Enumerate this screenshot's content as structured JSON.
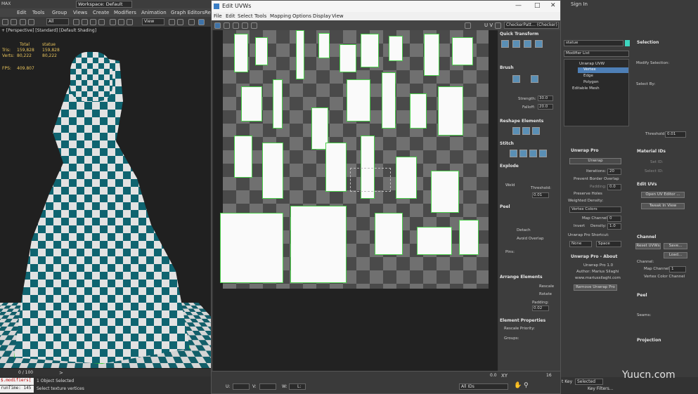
{
  "app": {
    "logo": "MAX",
    "workspace": "Workspace: Default",
    "menus": [
      "Edit",
      "Tools",
      "Group",
      "Views",
      "Create",
      "Modifiers",
      "Animation",
      "Graph Editors",
      "Re"
    ],
    "sign_in": "Sign In",
    "toolbar_filter": "All",
    "toolbar_view": "View"
  },
  "viewport": {
    "label": "+ [Perspective] [Standard] [Default Shading]",
    "stats_header_total": "Total",
    "stats_header_obj": "statue",
    "tris_label": "Tris:",
    "tris_total": "159,828",
    "tris_obj": "159,828",
    "verts_label": "Verts:",
    "verts_total": "80,222",
    "verts_obj": "80,222",
    "fps_label": "FPS:",
    "fps_value": "409.807"
  },
  "timeline": {
    "frame": "0 / 100"
  },
  "status": {
    "maxscript": "$.modifiers[",
    "runtime": "runTime: 145",
    "selection": "1 Object Selected",
    "prompt": "Select texture vertices"
  },
  "uvw": {
    "title": "Edit UVWs",
    "menus": [
      "File",
      "Edit",
      "Select",
      "Tools",
      "Mapping",
      "Options",
      "Display",
      "View"
    ],
    "uv_label": "U V",
    "checker_map": "CheckerPatt... (Checker)",
    "rollouts": {
      "quick_transform": "Quick Transform",
      "brush": "Brush",
      "strength_label": "Strength:",
      "strength_value": "30.0",
      "falloff_label": "Falloff:",
      "falloff_value": "20.0",
      "reshape": "Reshape Elements",
      "stitch": "Stitch",
      "explode": "Explode",
      "weld": "Weld",
      "threshold_label": "Threshold:",
      "threshold_value": "0.01",
      "peel": "Peel",
      "detach": "Detach",
      "avoid_overlap": "Avoid Overlap",
      "pins": "Pins:",
      "arrange": "Arrange Elements",
      "rescale": "Rescale",
      "rotate": "Rotate",
      "padding_label": "Padding:",
      "padding_value": "0.02",
      "element_props": "Element Properties",
      "rescale_priority": "Rescale Priority:",
      "groups": "Groups:"
    },
    "bottom": {
      "u_label": "U:",
      "v_label": "V:",
      "w_label": "W:",
      "l_label": "L:",
      "xy": "XY",
      "ids": "All IDs",
      "zoom_value": "0.0",
      "grid_value": "16"
    }
  },
  "command_panel": {
    "object_name": "statue",
    "modifier_list": "Modifier List",
    "stack": [
      "Unwrap UVW",
      "Vertex",
      "Edge",
      "Polygon",
      "Editable Mesh"
    ],
    "selection": {
      "title": "Selection",
      "modify_selection": "Modify Selection:",
      "select_by": "Select By:",
      "threshold_label": "Threshold:",
      "threshold_value": "0.01"
    },
    "unwrap_pro": {
      "title": "Unwrap Pro",
      "unwrap_button": "Unwrap",
      "iterations_label": "Iterations:",
      "iterations_value": "20",
      "prevent_border": "Prevent Border Overlap",
      "padding_label": "Padding:",
      "padding_value": "0.0",
      "preserve_holes": "Preserve Holes",
      "weighted_density": "Weighted Density:",
      "vertex_colors": "Vertex Colors",
      "map_channel_label": "Map Channel:",
      "map_channel_value": "0",
      "invert": "Invert",
      "density_label": "Density:",
      "density_value": "1.0",
      "shortcut": "Unwrap Pro Shortcut:",
      "shortcut_none": "None",
      "shortcut_space": "Space"
    },
    "about": {
      "title": "Unwrap Pro - About",
      "version": "Unwrap Pro 1.0",
      "author": "Author: Marius Silaghi",
      "site": "www.mariussilaghi.com",
      "remove": "Remove Unwrap Pro"
    },
    "material_ids": {
      "title": "Material IDs",
      "set_id": "Set ID:",
      "select_id": "Select ID:"
    },
    "edit_uvs": {
      "title": "Edit UVs",
      "open_editor": "Open UV Editor ...",
      "tweak": "Tweak In View"
    },
    "channel": {
      "title": "Channel",
      "reset": "Reset UVWs",
      "save": "Save...",
      "load": "Load...",
      "channel_label": "Channel:",
      "map_channel": "Map Channel:",
      "map_channel_value": "1",
      "vertex_color_channel": "Vertex Color Channel"
    },
    "peel": {
      "title": "Peel",
      "seams": "Seams:"
    },
    "projection": {
      "title": "Projection"
    },
    "bottom": {
      "selected": "Selected",
      "key_filters": "Key Filters...",
      "set_key": "t Key"
    }
  },
  "watermark": "Yuucn.com"
}
